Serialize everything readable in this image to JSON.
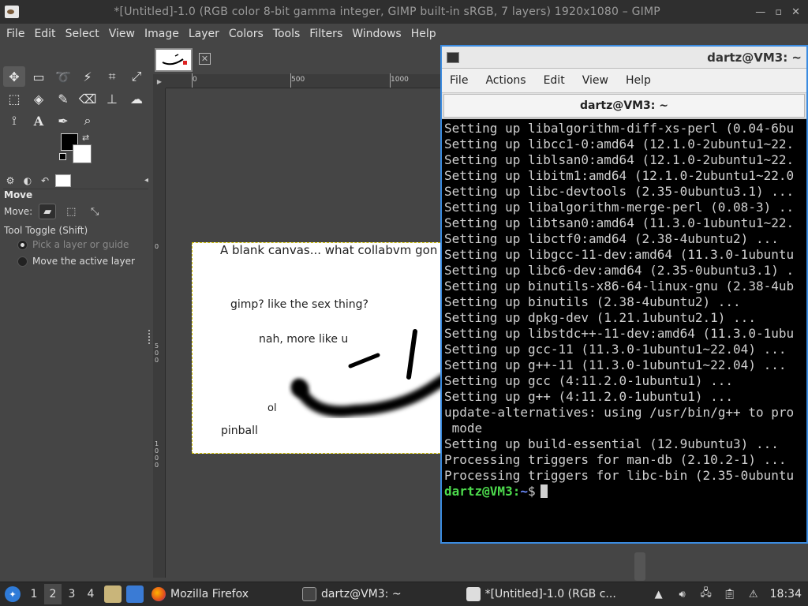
{
  "gimp": {
    "title": "*[Untitled]-1.0 (RGB color 8-bit gamma integer, GIMP built-in sRGB, 7 layers) 1920x1080 – GIMP",
    "menu": [
      "File",
      "Edit",
      "Select",
      "View",
      "Image",
      "Layer",
      "Colors",
      "Tools",
      "Filters",
      "Windows",
      "Help"
    ],
    "tool_options": {
      "title": "Move",
      "move_label": "Move:",
      "toggle_label": "Tool Toggle  (Shift)",
      "option_pick": "Pick a layer or guide",
      "option_move_active": "Move the active layer"
    },
    "ruler": {
      "h_labels": [
        "0",
        "500",
        "1000"
      ],
      "v_labels": [
        "0",
        "500",
        "1000"
      ]
    },
    "canvas_text": {
      "line1": "A blank canvas... what collabvm gon",
      "line2": "gimp? like the sex thing?",
      "line3": "nah, more like u",
      "line4": "ol",
      "line5": "pinball"
    }
  },
  "terminal": {
    "window_title": "dartz@VM3: ~",
    "tab_title": "dartz@VM3: ~",
    "menu": [
      "File",
      "Actions",
      "Edit",
      "View",
      "Help"
    ],
    "lines": [
      "Setting up libalgorithm-diff-xs-perl (0.04-6bu",
      "Setting up libcc1-0:amd64 (12.1.0-2ubuntu1~22.",
      "Setting up liblsan0:amd64 (12.1.0-2ubuntu1~22.",
      "Setting up libitm1:amd64 (12.1.0-2ubuntu1~22.0",
      "Setting up libc-devtools (2.35-0ubuntu3.1) ...",
      "Setting up libalgorithm-merge-perl (0.08-3) ..",
      "Setting up libtsan0:amd64 (11.3.0-1ubuntu1~22.",
      "Setting up libctf0:amd64 (2.38-4ubuntu2) ...",
      "Setting up libgcc-11-dev:amd64 (11.3.0-1ubuntu",
      "Setting up libc6-dev:amd64 (2.35-0ubuntu3.1) .",
      "Setting up binutils-x86-64-linux-gnu (2.38-4ub",
      "Setting up binutils (2.38-4ubuntu2) ...",
      "Setting up dpkg-dev (1.21.1ubuntu2.1) ...",
      "Setting up libstdc++-11-dev:amd64 (11.3.0-1ubu",
      "Setting up gcc-11 (11.3.0-1ubuntu1~22.04) ...",
      "Setting up g++-11 (11.3.0-1ubuntu1~22.04) ...",
      "Setting up gcc (4:11.2.0-1ubuntu1) ...",
      "Setting up g++ (4:11.2.0-1ubuntu1) ...",
      "update-alternatives: using /usr/bin/g++ to pro",
      " mode",
      "Setting up build-essential (12.9ubuntu3) ...",
      "Processing triggers for man-db (2.10.2-1) ...",
      "Processing triggers for libc-bin (2.35-0ubuntu"
    ],
    "prompt_user": "dartz@VM3",
    "prompt_sep": ":",
    "prompt_path": "~",
    "prompt_symbol": "$"
  },
  "taskbar": {
    "workspaces": [
      "1",
      "2",
      "3",
      "4"
    ],
    "active_workspace": "2",
    "tasks": [
      {
        "label": "Mozilla Firefox",
        "icon": "firefox-icon"
      },
      {
        "label": "dartz@VM3: ~",
        "icon": "terminal-icon"
      },
      {
        "label": "*[Untitled]-1.0 (RGB c...",
        "icon": "gimp-icon"
      }
    ],
    "clock": "18:34"
  },
  "colors": {
    "terminal_border": "#3b8be0",
    "prompt_user": "#4ddc4d",
    "prompt_path": "#6c8cff",
    "canvas_border": "#d4c300"
  }
}
